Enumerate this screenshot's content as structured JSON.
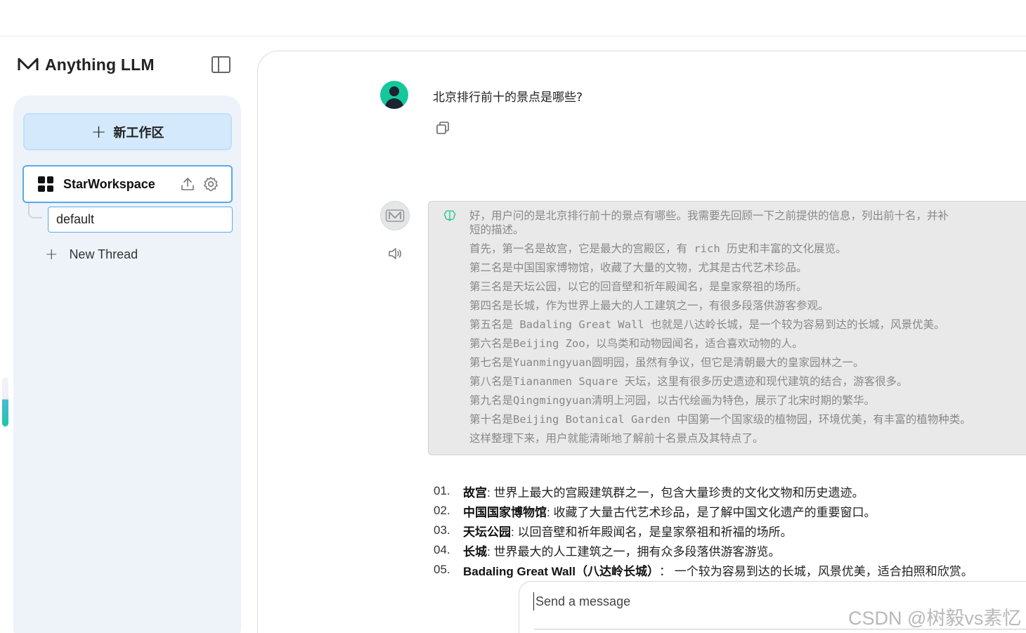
{
  "app": {
    "brand": "Anything LLM",
    "accent_color": "#5aa9e6",
    "user_avatar_color": "#15c89c"
  },
  "sidebar": {
    "new_workspace_label": "新工作区",
    "workspace": {
      "name": "StarWorkspace",
      "icons": [
        "upload-icon",
        "gear-icon"
      ]
    },
    "threads": [
      {
        "label": "default",
        "selected": true
      }
    ],
    "new_thread_label": "New Thread"
  },
  "chat": {
    "user_message": "北京排行前十的景点是哪些?",
    "thinking_lines": [
      "好，用户问的是北京排行前十的景点有哪些。我需要先回顾一下之前提供的信息，列出前十名，并补",
      "短的描述。",
      "首先，第一名是故宫，它是最大的宫殿区，有 rich 历史和丰富的文化展览。",
      "第二名是中国国家博物馆，收藏了大量的文物，尤其是古代艺术珍品。",
      "第三名是天坛公园，以它的回音壁和祈年殿闻名，是皇家祭祖的场所。",
      "第四名是长城，作为世界上最大的人工建筑之一，有很多段落供游客参观。",
      "第五名是 Badaling Great Wall 也就是八达岭长城，是一个较为容易到达的长城，风景优美。",
      "第六名是Beijing Zoo，以鸟类和动物园闻名，适合喜欢动物的人。",
      "第七名是Yuanmingyuan圆明园，虽然有争议，但它是清朝最大的皇家园林之一。",
      "第八名是Tiananmen Square 天坛，这里有很多历史遗迹和现代建筑的结合，游客很多。",
      "第九名是Qingmingyuan清明上河园，以古代绘画为特色，展示了北宋时期的繁华。",
      "第十名是Beijing Botanical Garden 中国第一个国家级的植物园，环境优美，有丰富的植物种类。",
      "这样整理下来，用户就能清晰地了解前十名景点及其特点了。"
    ],
    "answer": [
      {
        "num": "01.",
        "name": "故宫",
        "desc": ": 世界上最大的宫殿建筑群之一，包含大量珍贵的文化文物和历史遗迹。"
      },
      {
        "num": "02.",
        "name": "中国国家博物馆",
        "desc": ": 收藏了大量古代艺术珍品，是了解中国文化遗产的重要窗口。"
      },
      {
        "num": "03.",
        "name": "天坛公园",
        "desc": ": 以回音壁和祈年殿闻名，是皇家祭祖和祈福的场所。"
      },
      {
        "num": "04.",
        "name": "长城",
        "desc": ": 世界最大的人工建筑之一，拥有众多段落供游客游览。"
      },
      {
        "num": "05.",
        "name": "Badaling Great Wall（八达岭长城）",
        "desc": "： 一个较为容易到达的长城，风景优美，适合拍照和欣赏。"
      }
    ]
  },
  "composer": {
    "placeholder": "Send a message"
  },
  "watermark": "CSDN @树毅vs素忆"
}
